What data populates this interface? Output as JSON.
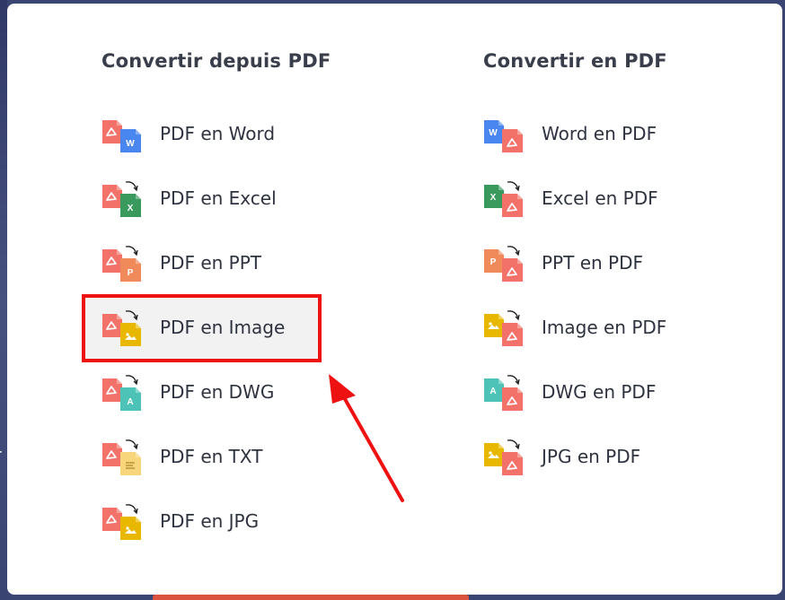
{
  "left_column": {
    "title": "Convertir depuis PDF",
    "items": [
      {
        "label": "PDF en Word",
        "icon": "pdf-to-word-icon",
        "source_color": "#f2726a",
        "target_color": "#4a86f0",
        "target_glyph": "W",
        "curved_arrow": false
      },
      {
        "label": "PDF en Excel",
        "icon": "pdf-to-excel-icon",
        "source_color": "#f2726a",
        "target_color": "#3a9a5e",
        "target_glyph": "X",
        "curved_arrow": true
      },
      {
        "label": "PDF en PPT",
        "icon": "pdf-to-ppt-icon",
        "source_color": "#f2726a",
        "target_color": "#f08a5a",
        "target_glyph": "P",
        "curved_arrow": true
      },
      {
        "label": "PDF en Image",
        "icon": "pdf-to-image-icon",
        "source_color": "#f2726a",
        "target_color": "#e8b800",
        "target_glyph": "",
        "curved_arrow": true
      },
      {
        "label": "PDF en DWG",
        "icon": "pdf-to-dwg-icon",
        "source_color": "#f2726a",
        "target_color": "#4cc3b6",
        "target_glyph": "A",
        "curved_arrow": true
      },
      {
        "label": "PDF en TXT",
        "icon": "pdf-to-txt-icon",
        "source_color": "#f2726a",
        "target_color": "#f7d57a",
        "target_glyph": "",
        "curved_arrow": true
      },
      {
        "label": "PDF en JPG",
        "icon": "pdf-to-jpg-icon",
        "source_color": "#f2726a",
        "target_color": "#e8b800",
        "target_glyph": "",
        "curved_arrow": true
      }
    ]
  },
  "right_column": {
    "title": "Convertir en PDF",
    "items": [
      {
        "label": "Word en PDF",
        "icon": "word-to-pdf-icon",
        "source_color": "#4a86f0",
        "source_glyph": "W",
        "curved_arrow": false
      },
      {
        "label": "Excel en PDF",
        "icon": "excel-to-pdf-icon",
        "source_color": "#3a9a5e",
        "source_glyph": "X",
        "curved_arrow": true
      },
      {
        "label": "PPT en PDF",
        "icon": "ppt-to-pdf-icon",
        "source_color": "#f08a5a",
        "source_glyph": "P",
        "curved_arrow": true
      },
      {
        "label": "Image en PDF",
        "icon": "image-to-pdf-icon",
        "source_color": "#e8b800",
        "source_glyph": "",
        "curved_arrow": true
      },
      {
        "label": "DWG en PDF",
        "icon": "dwg-to-pdf-icon",
        "source_color": "#4cc3b6",
        "source_glyph": "A",
        "curved_arrow": true
      },
      {
        "label": "JPG en PDF",
        "icon": "jpg-to-pdf-icon",
        "source_color": "#e8b800",
        "source_glyph": "",
        "curved_arrow": true
      }
    ]
  },
  "highlighted_item": "PDF en Image",
  "annotation_color": "#ee1111",
  "backdrop_edge_text": "r"
}
